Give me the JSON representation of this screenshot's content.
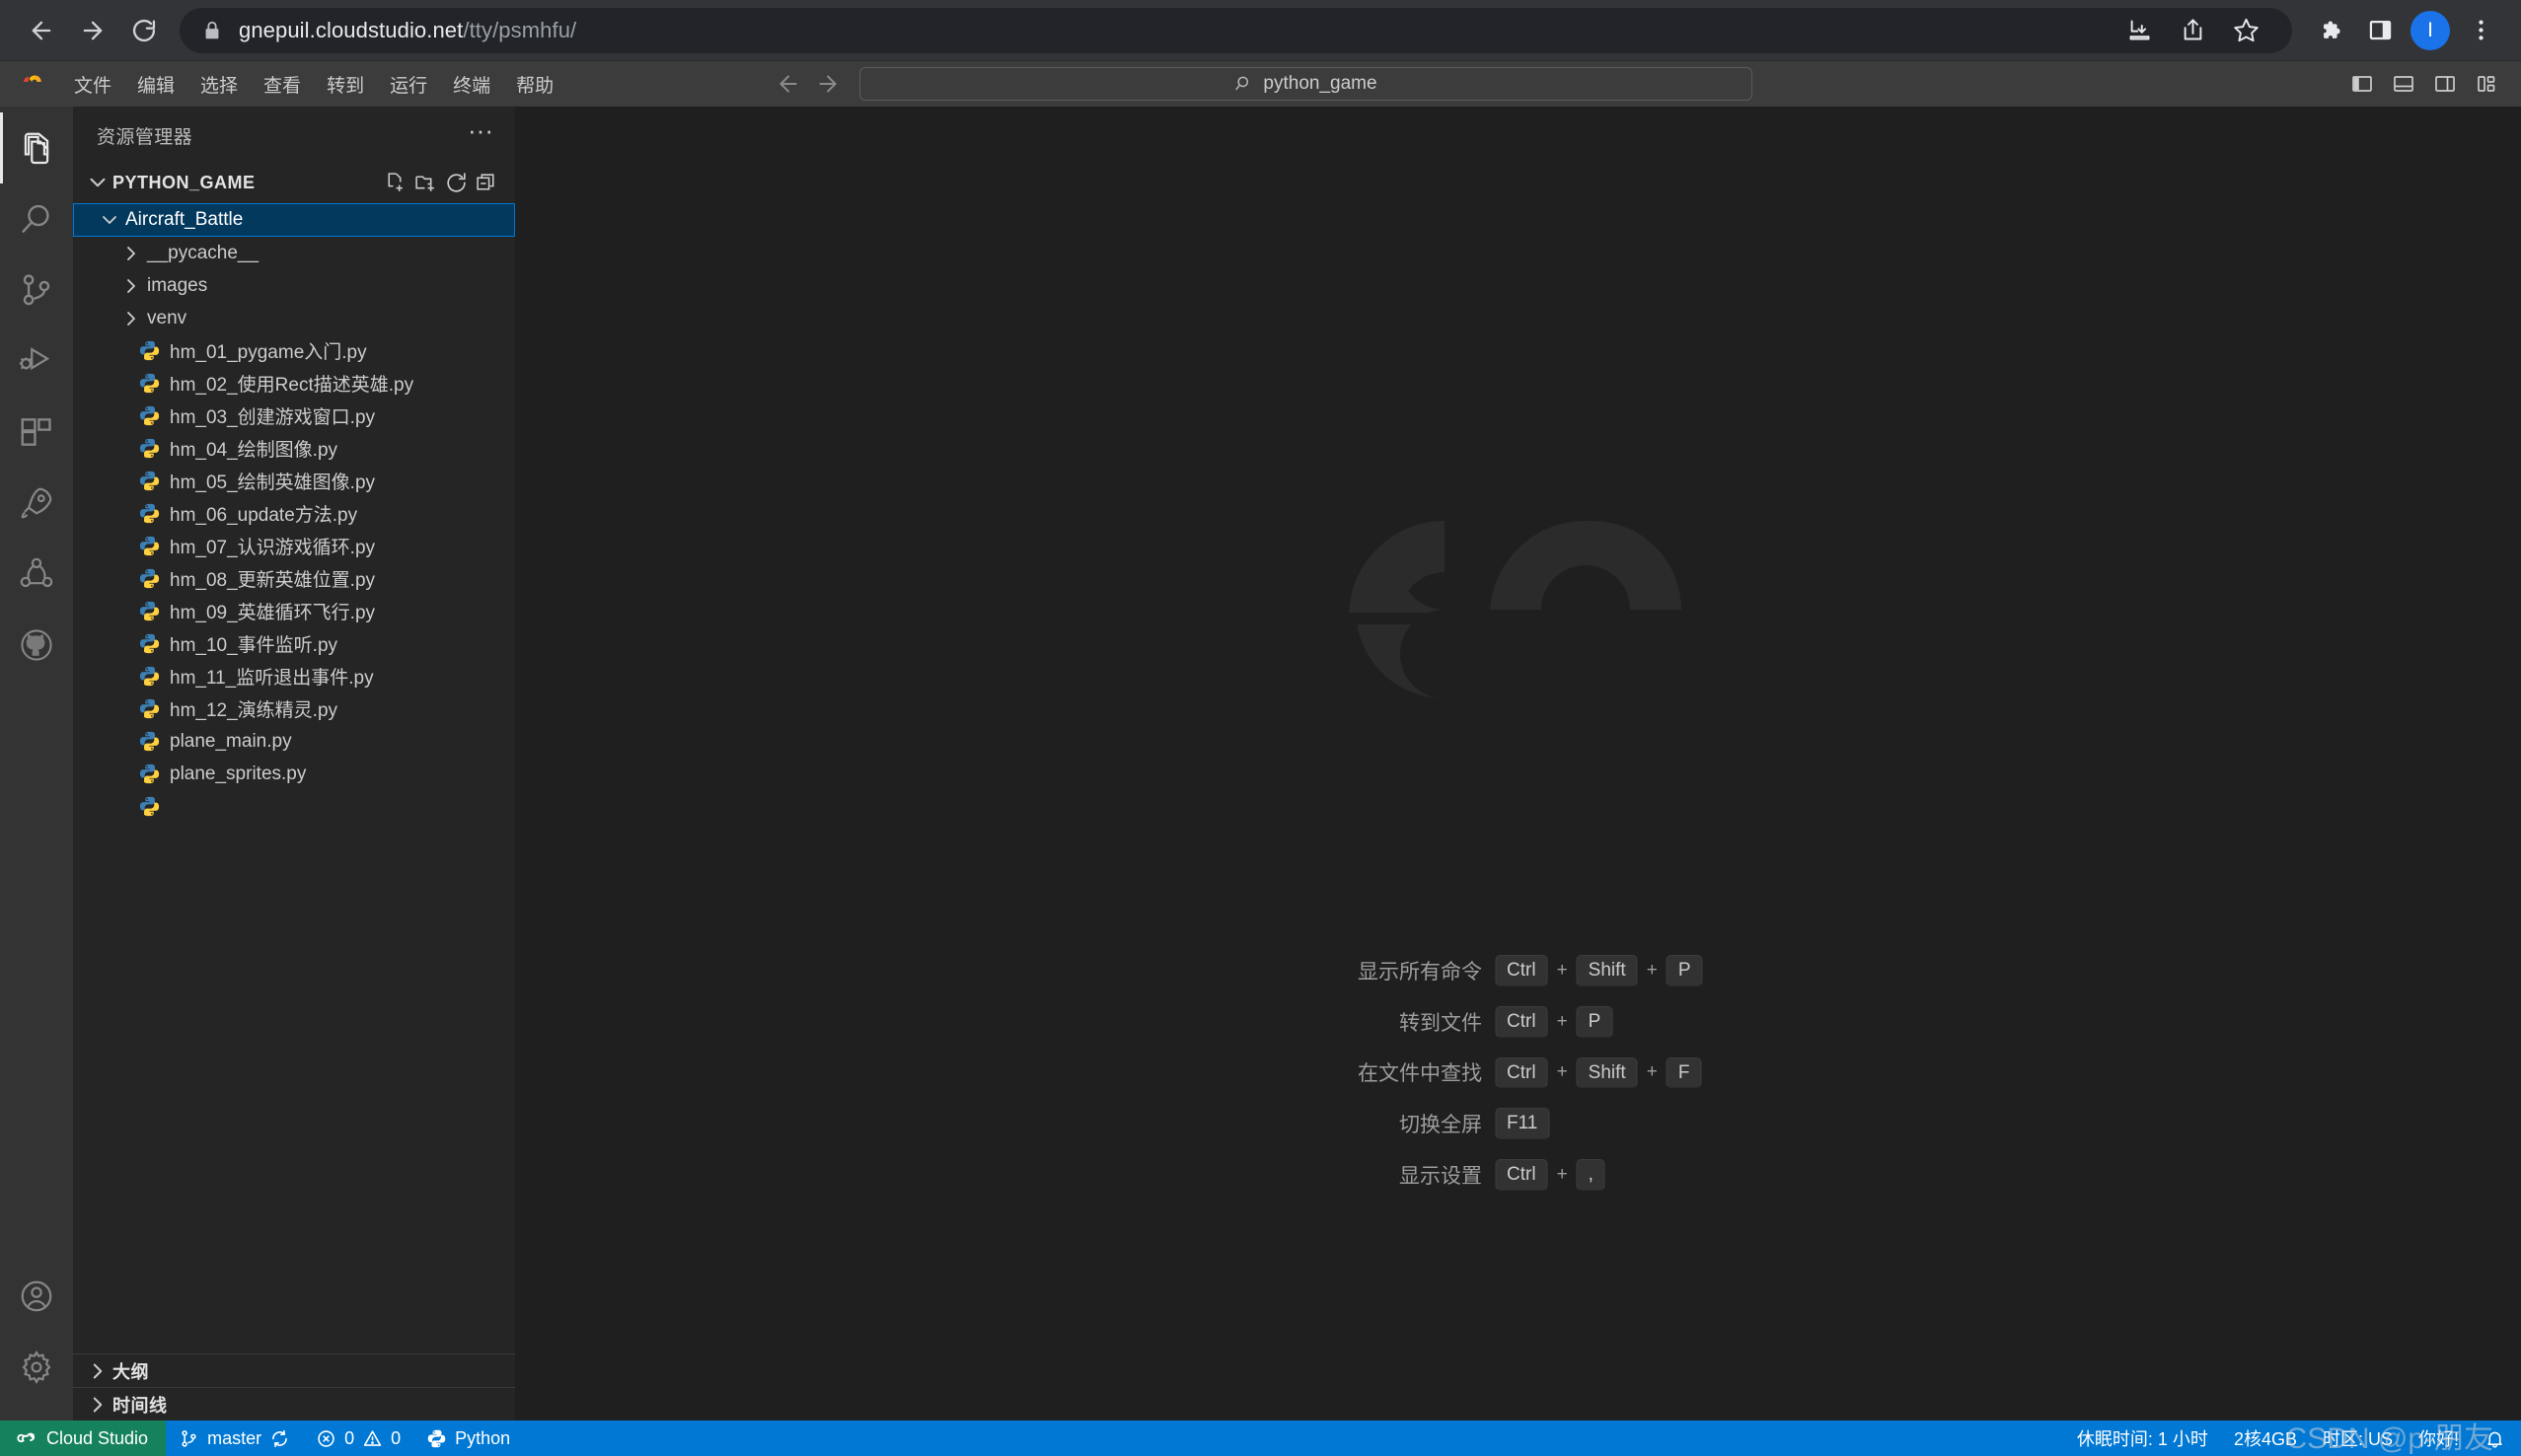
{
  "browser": {
    "url_domain": "gnepuil.cloudstudio.net",
    "url_path": "/tty/psmhfu/",
    "back_icon": "back-arrow-icon",
    "forward_icon": "forward-arrow-icon",
    "reload_icon": "reload-icon",
    "lock_icon": "lock-icon",
    "install_icon": "install-app-icon",
    "share_icon": "share-icon",
    "bookmark_icon": "star-icon",
    "extensions_icon": "puzzle-icon",
    "sidepanel_icon": "side-panel-icon",
    "avatar_letter": "I",
    "menu_icon": "three-dots-menu-icon"
  },
  "titlebar": {
    "logo": "cloud-studio-logo",
    "menus": [
      "文件",
      "编辑",
      "选择",
      "查看",
      "转到",
      "运行",
      "终端",
      "帮助"
    ],
    "command_center": {
      "value": "python_game",
      "icon": "search-icon"
    },
    "nav_back": "back-arrow-icon",
    "nav_forward": "forward-arrow-icon",
    "layout_buttons": [
      {
        "name": "toggle-primary-sidebar",
        "icon": "layout-sidebar-left-icon"
      },
      {
        "name": "toggle-panel",
        "icon": "layout-panel-icon"
      },
      {
        "name": "toggle-secondary-sidebar",
        "icon": "layout-sidebar-right-icon"
      },
      {
        "name": "customize-layout",
        "icon": "layout-customize-icon"
      }
    ]
  },
  "activitybar": {
    "items": [
      {
        "name": "explorer",
        "icon": "files-icon",
        "active": true
      },
      {
        "name": "search",
        "icon": "search-icon",
        "active": false
      },
      {
        "name": "source-control",
        "icon": "source-control-icon",
        "active": false
      },
      {
        "name": "run-and-debug",
        "icon": "run-debug-icon",
        "active": false
      },
      {
        "name": "extensions",
        "icon": "extensions-icon",
        "active": false
      },
      {
        "name": "deploy",
        "icon": "rocket-icon",
        "active": false
      },
      {
        "name": "collaborate",
        "icon": "share-network-icon",
        "active": false
      },
      {
        "name": "github",
        "icon": "github-icon",
        "active": false
      }
    ],
    "bottom": [
      {
        "name": "accounts",
        "icon": "account-icon"
      },
      {
        "name": "manage-settings",
        "icon": "gear-icon"
      }
    ]
  },
  "sidebar": {
    "title": "资源管理器",
    "more_actions": "···",
    "project": {
      "label": "PYTHON_GAME",
      "expanded": true,
      "actions": [
        {
          "name": "new-file",
          "icon": "new-file-icon"
        },
        {
          "name": "new-folder",
          "icon": "new-folder-icon"
        },
        {
          "name": "refresh-explorer",
          "icon": "refresh-icon"
        },
        {
          "name": "collapse-folders",
          "icon": "collapse-all-icon"
        }
      ]
    },
    "tree": [
      {
        "label": "Aircraft_Battle",
        "type": "folder",
        "expanded": true,
        "selected": true,
        "indent": 1
      },
      {
        "label": "__pycache__",
        "type": "folder",
        "expanded": false,
        "selected": false,
        "indent": 2
      },
      {
        "label": "images",
        "type": "folder",
        "expanded": false,
        "selected": false,
        "indent": 2
      },
      {
        "label": "venv",
        "type": "folder",
        "expanded": false,
        "selected": false,
        "indent": 2
      },
      {
        "label": "hm_01_pygame入门.py",
        "type": "python",
        "indent": 2
      },
      {
        "label": "hm_02_使用Rect描述英雄.py",
        "type": "python",
        "indent": 2
      },
      {
        "label": "hm_03_创建游戏窗口.py",
        "type": "python",
        "indent": 2
      },
      {
        "label": "hm_04_绘制图像.py",
        "type": "python",
        "indent": 2
      },
      {
        "label": "hm_05_绘制英雄图像.py",
        "type": "python",
        "indent": 2
      },
      {
        "label": "hm_06_update方法.py",
        "type": "python",
        "indent": 2
      },
      {
        "label": "hm_07_认识游戏循环.py",
        "type": "python",
        "indent": 2
      },
      {
        "label": "hm_08_更新英雄位置.py",
        "type": "python",
        "indent": 2
      },
      {
        "label": "hm_09_英雄循环飞行.py",
        "type": "python",
        "indent": 2
      },
      {
        "label": "hm_10_事件监听.py",
        "type": "python",
        "indent": 2
      },
      {
        "label": "hm_11_监听退出事件.py",
        "type": "python",
        "indent": 2
      },
      {
        "label": "hm_12_演练精灵.py",
        "type": "python",
        "indent": 2
      },
      {
        "label": "plane_main.py",
        "type": "python",
        "indent": 2
      },
      {
        "label": "plane_sprites.py",
        "type": "python",
        "indent": 2
      }
    ],
    "bottom_sections": [
      {
        "label": "大纲",
        "expanded": false
      },
      {
        "label": "时间线",
        "expanded": false
      }
    ]
  },
  "editor": {
    "watermark_icon": "cloud-studio-watermark-logo",
    "shortcuts": [
      {
        "label": "显示所有命令",
        "keys": [
          "Ctrl",
          "Shift",
          "P"
        ]
      },
      {
        "label": "转到文件",
        "keys": [
          "Ctrl",
          "P"
        ]
      },
      {
        "label": "在文件中查找",
        "keys": [
          "Ctrl",
          "Shift",
          "F"
        ]
      },
      {
        "label": "切换全屏",
        "keys": [
          "F11"
        ]
      },
      {
        "label": "显示设置",
        "keys": [
          "Ctrl",
          ","
        ]
      }
    ],
    "key_separator": "+"
  },
  "statusbar": {
    "cloud_label": "Cloud Studio",
    "cloud_icon": "cloud-studio-mark-icon",
    "branch": "master",
    "branch_icon": "source-control-icon",
    "sync_icon": "sync-icon",
    "errors": "0",
    "errors_icon": "error-circle-icon",
    "warnings": "0",
    "warnings_icon": "warning-triangle-icon",
    "language": "Python",
    "language_icon": "python-icon",
    "sleep_time": "休眠时间: 1 小时",
    "spec": "2核4GB",
    "timezone": "时区: US",
    "greeting": "你好!",
    "bell_icon": "bell-icon",
    "watermark": "CSDN @p-朋友"
  },
  "colors": {
    "accent_blue": "#0078d4",
    "selection_bg": "#04395e",
    "cloud_green": "#16825d",
    "sidebar_bg": "#252526",
    "editor_bg": "#1f1f1f",
    "activitybar_bg": "#333333"
  }
}
